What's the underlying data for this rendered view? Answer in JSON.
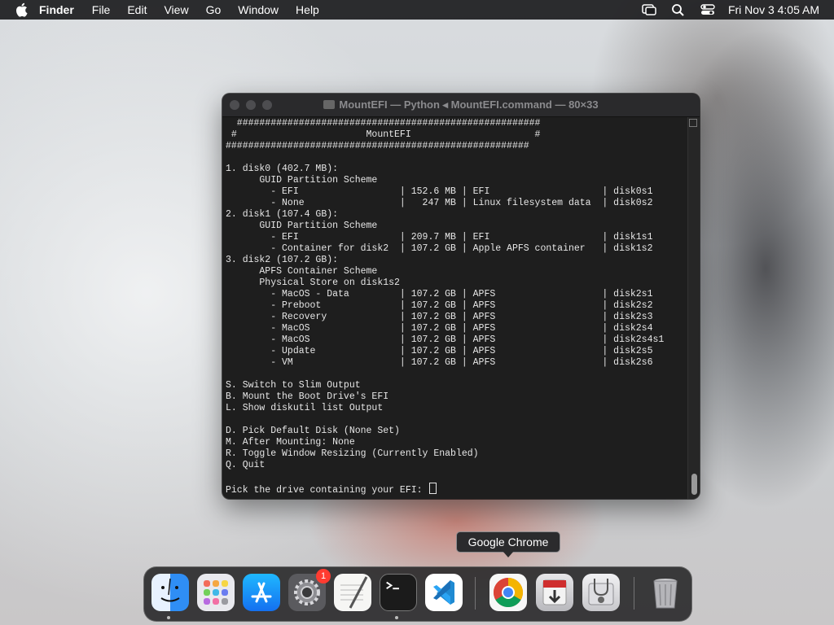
{
  "menubar": {
    "app_name": "Finder",
    "menus": [
      "File",
      "Edit",
      "View",
      "Go",
      "Window",
      "Help"
    ],
    "clock": "Fri Nov 3  4:05 AM"
  },
  "window": {
    "title": "MountEFI — Python ◂ MountEFI.command — 80×33"
  },
  "terminal": {
    "lines": [
      "  ######################################################",
      " #                       MountEFI                      #",
      "######################################################",
      "",
      "1. disk0 (402.7 MB):",
      "      GUID Partition Scheme",
      "        - EFI                  | 152.6 MB | EFI                    | disk0s1",
      "        - None                 |   247 MB | Linux filesystem data  | disk0s2",
      "2. disk1 (107.4 GB):",
      "      GUID Partition Scheme",
      "        - EFI                  | 209.7 MB | EFI                    | disk1s1",
      "        - Container for disk2  | 107.2 GB | Apple APFS container   | disk1s2",
      "3. disk2 (107.2 GB):",
      "      APFS Container Scheme",
      "      Physical Store on disk1s2",
      "        - MacOS - Data         | 107.2 GB | APFS                   | disk2s1",
      "        - Preboot              | 107.2 GB | APFS                   | disk2s2",
      "        - Recovery             | 107.2 GB | APFS                   | disk2s3",
      "        - MacOS                | 107.2 GB | APFS                   | disk2s4",
      "        - MacOS                | 107.2 GB | APFS                   | disk2s4s1",
      "        - Update               | 107.2 GB | APFS                   | disk2s5",
      "        - VM                   | 107.2 GB | APFS                   | disk2s6",
      "",
      "S. Switch to Slim Output",
      "B. Mount the Boot Drive's EFI",
      "L. Show diskutil list Output",
      "",
      "D. Pick Default Disk (None Set)",
      "M. After Mounting: None",
      "R. Toggle Window Resizing (Currently Enabled)",
      "Q. Quit",
      ""
    ],
    "prompt": "Pick the drive containing your EFI: "
  },
  "tooltip": "Google Chrome",
  "dock": {
    "items": [
      {
        "name": "Finder",
        "icon": "finder-icon",
        "running": true
      },
      {
        "name": "Launchpad",
        "icon": "launchpad-icon",
        "running": false
      },
      {
        "name": "App Store",
        "icon": "app-store-icon",
        "running": false
      },
      {
        "name": "System Settings",
        "icon": "system-settings-icon",
        "running": false,
        "badge": "1"
      },
      {
        "name": "TextEdit",
        "icon": "textedit-icon",
        "running": false
      },
      {
        "name": "Terminal",
        "icon": "terminal-icon",
        "running": true
      },
      {
        "name": "Visual Studio Code",
        "icon": "vscode-icon",
        "running": false
      },
      {
        "name": "Google Chrome",
        "icon": "chrome-icon",
        "running": false
      },
      {
        "name": "Installer",
        "icon": "installer-icon",
        "running": false
      },
      {
        "name": "Disk Utility",
        "icon": "disk-utility-icon",
        "running": false
      },
      {
        "name": "Trash",
        "icon": "trash-icon",
        "running": false
      }
    ],
    "badge_system_settings": "1"
  },
  "colors": {
    "terminal_bg": "#1e1e1e",
    "terminal_fg": "#e6e6e6",
    "menubar_bg": "#1c1c1e",
    "badge": "#ff3b30"
  }
}
